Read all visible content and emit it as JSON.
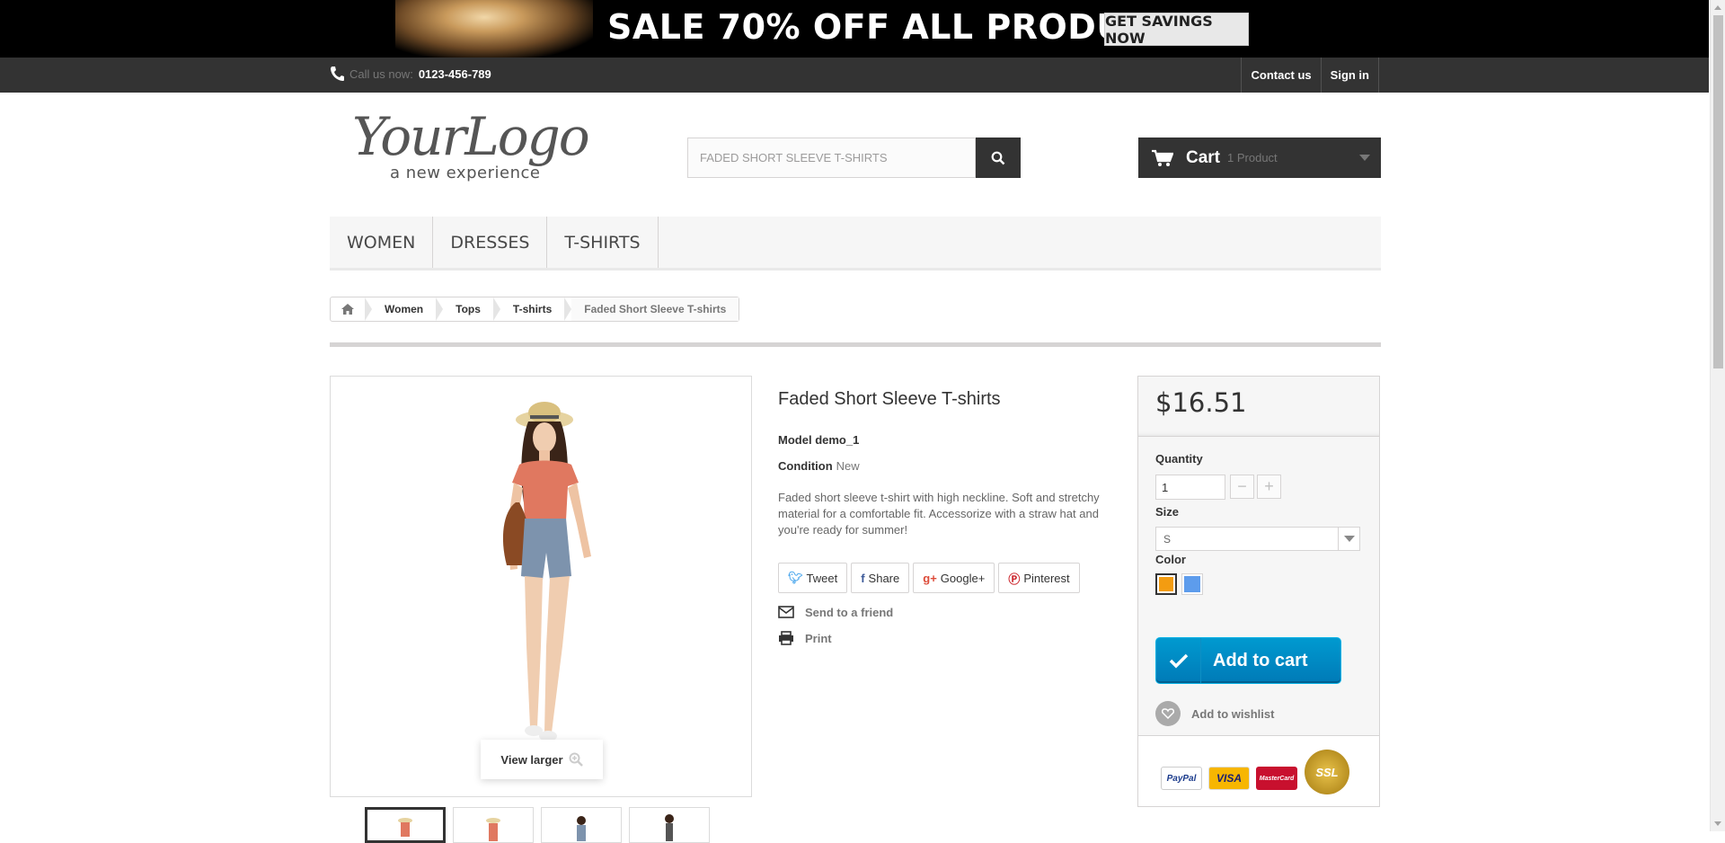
{
  "banner": {
    "headline": "SALE 70% OFF ALL PRODUCTS",
    "cta": "GET SAVINGS NOW"
  },
  "topbar": {
    "call_label": "Call us now:",
    "phone": "0123-456-789",
    "links": [
      "Contact us",
      "Sign in"
    ]
  },
  "logo": {
    "main": "YourLogo",
    "tagline": "a new experience"
  },
  "search": {
    "value": "FADED SHORT SLEEVE T-SHIRTS"
  },
  "cart": {
    "label": "Cart",
    "count": "1 Product"
  },
  "menu": [
    "WOMEN",
    "DRESSES",
    "T-SHIRTS"
  ],
  "breadcrumb": [
    "Women",
    "Tops",
    "T-shirts",
    "Faded Short Sleeve T-shirts"
  ],
  "product": {
    "title": "Faded Short Sleeve T-shirts",
    "model_label": "Model",
    "model_value": "demo_1",
    "condition_label": "Condition",
    "condition_value": "New",
    "description": "Faded short sleeve t-shirt with high neckline. Soft and stretchy material for a comfortable fit. Accessorize with a straw hat and you're ready for summer!",
    "view_larger": "View larger"
  },
  "social": [
    {
      "icon": "twitter-icon",
      "label": "Tweet"
    },
    {
      "icon": "facebook-icon",
      "label": "Share"
    },
    {
      "icon": "google-plus-icon",
      "label": "Google+"
    },
    {
      "icon": "pinterest-icon",
      "label": "Pinterest"
    }
  ],
  "actions": {
    "send": "Send to a friend",
    "print": "Print"
  },
  "buy": {
    "price": "$16.51",
    "quantity_label": "Quantity",
    "quantity_value": "1",
    "size_label": "Size",
    "size_value": "S",
    "color_label": "Color",
    "colors": [
      "#f39c11",
      "#5d9cec"
    ],
    "add_to_cart": "Add to cart",
    "wishlist": "Add to wishlist"
  },
  "payments": [
    "PayPal",
    "VISA",
    "MasterCard",
    "SSL"
  ],
  "colors": {
    "accent_blue": "#009ad0",
    "dark": "#333333"
  }
}
